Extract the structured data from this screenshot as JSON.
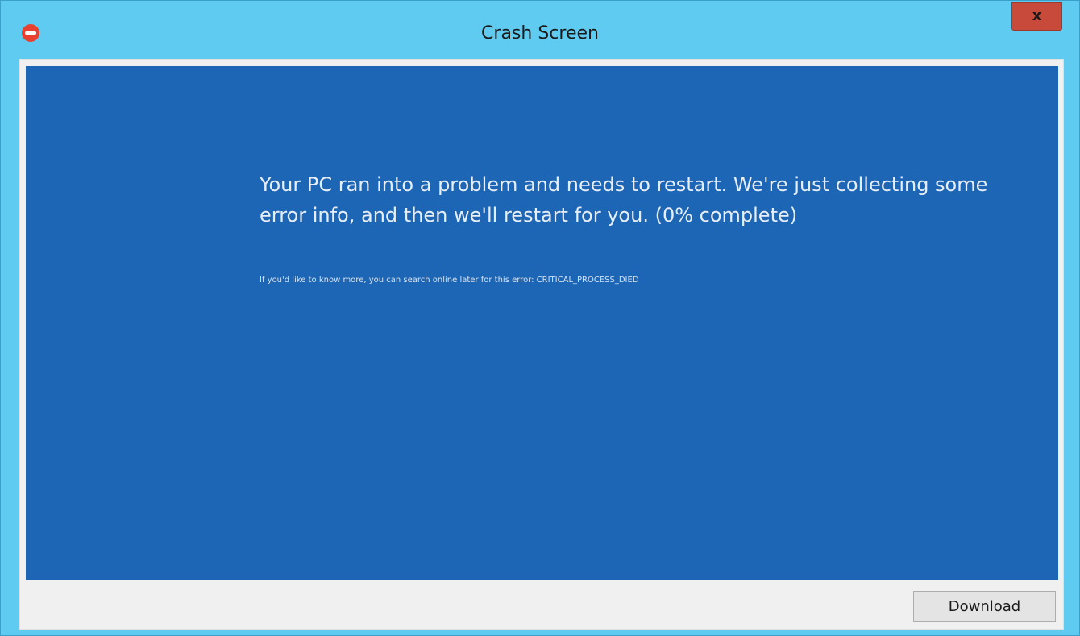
{
  "window": {
    "title": "Crash Screen",
    "close_label": "x",
    "app_icon": "red-circle-app-icon"
  },
  "crash": {
    "message": "Your PC ran into a problem and needs to restart. We're just collecting some error info, and then we'll restart for you. (0% complete)",
    "detail": "If you'd like to know more, you can search online later for this error: CRITICAL_PROCESS_DIED",
    "progress_percent": 0
  },
  "footer": {
    "download_label": "Download"
  },
  "colors": {
    "titlebar": "#5fcbf0",
    "bsod_background": "#1c66b5",
    "close_button": "#c74a3a",
    "app_icon": "#e8412f"
  }
}
